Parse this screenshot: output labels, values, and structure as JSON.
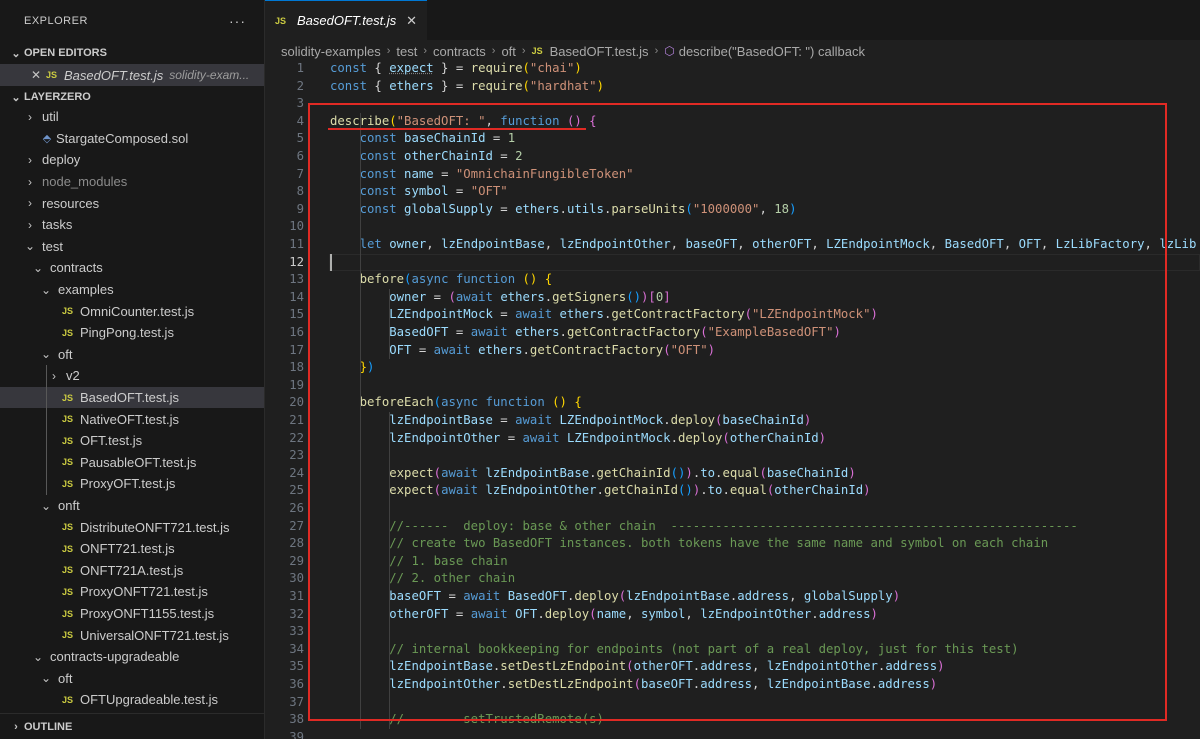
{
  "explorer": {
    "title": "EXPLORER",
    "more": "···"
  },
  "open_editors": {
    "title": "OPEN EDITORS",
    "item": {
      "icon": "js-file-icon",
      "name": "BasedOFT.test.js",
      "desc": "solidity-exam..."
    }
  },
  "workspace": {
    "title": "LAYERZERO"
  },
  "tree": [
    {
      "label": "util",
      "type": "folder",
      "expanded": false
    },
    {
      "label": "StargateComposed.sol",
      "type": "sol"
    },
    {
      "label": "deploy",
      "type": "folder",
      "expanded": false
    },
    {
      "label": "node_modules",
      "type": "folder",
      "expanded": false,
      "dim": true
    },
    {
      "label": "resources",
      "type": "folder",
      "expanded": false
    },
    {
      "label": "tasks",
      "type": "folder",
      "expanded": false
    },
    {
      "label": "test",
      "type": "folder",
      "expanded": true
    },
    {
      "label": "contracts",
      "type": "folder",
      "expanded": true
    },
    {
      "label": "examples",
      "type": "folder",
      "expanded": true
    },
    {
      "label": "OmniCounter.test.js",
      "type": "js"
    },
    {
      "label": "PingPong.test.js",
      "type": "js"
    },
    {
      "label": "oft",
      "type": "folder",
      "expanded": true
    },
    {
      "label": "v2",
      "type": "folder",
      "expanded": false
    },
    {
      "label": "BasedOFT.test.js",
      "type": "js",
      "selected": true
    },
    {
      "label": "NativeOFT.test.js",
      "type": "js"
    },
    {
      "label": "OFT.test.js",
      "type": "js"
    },
    {
      "label": "PausableOFT.test.js",
      "type": "js"
    },
    {
      "label": "ProxyOFT.test.js",
      "type": "js"
    },
    {
      "label": "onft",
      "type": "folder",
      "expanded": true
    },
    {
      "label": "DistributeONFT721.test.js",
      "type": "js"
    },
    {
      "label": "ONFT721.test.js",
      "type": "js"
    },
    {
      "label": "ONFT721A.test.js",
      "type": "js"
    },
    {
      "label": "ProxyONFT721.test.js",
      "type": "js"
    },
    {
      "label": "ProxyONFT1155.test.js",
      "type": "js"
    },
    {
      "label": "UniversalONFT721.test.js",
      "type": "js"
    },
    {
      "label": "contracts-upgradeable",
      "type": "folder",
      "expanded": true
    },
    {
      "label": "oft",
      "type": "folder",
      "expanded": true
    },
    {
      "label": "OFTUpgradeable.test.js",
      "type": "js"
    }
  ],
  "outline": {
    "title": "OUTLINE"
  },
  "tab": {
    "icon": "JS",
    "name": "BasedOFT.test.js",
    "close": "✕"
  },
  "breadcrumb": [
    "solidity-examples",
    "test",
    "contracts",
    "oft",
    "BasedOFT.test.js",
    "describe(\"BasedOFT: \") callback"
  ],
  "active_line": 12,
  "colors": {
    "highlight_box": "#e02a24",
    "accent": "#0078d4"
  },
  "code_lines": [
    [
      [
        "k",
        "const "
      ],
      [
        "p",
        "{ "
      ],
      [
        "v",
        "expect"
      ],
      [
        "p",
        " } = "
      ],
      [
        "f",
        "require"
      ],
      [
        "b1",
        "("
      ],
      [
        "s",
        "\"chai\""
      ],
      [
        "b1",
        ")"
      ]
    ],
    [
      [
        "k",
        "const "
      ],
      [
        "p",
        "{ "
      ],
      [
        "v",
        "ethers"
      ],
      [
        "p",
        " } = "
      ],
      [
        "f",
        "require"
      ],
      [
        "b1",
        "("
      ],
      [
        "s",
        "\"hardhat\""
      ],
      [
        "b1",
        ")"
      ]
    ],
    [],
    [
      [
        "f",
        "describe"
      ],
      [
        "b1",
        "("
      ],
      [
        "s",
        "\"BasedOFT: \""
      ],
      [
        "p",
        ", "
      ],
      [
        "k",
        "function"
      ],
      [
        "p",
        " "
      ],
      [
        "b2",
        "()"
      ],
      [
        "p",
        " "
      ],
      [
        "b2",
        "{"
      ]
    ],
    [
      [
        "p",
        "    "
      ],
      [
        "k",
        "const "
      ],
      [
        "v",
        "baseChainId"
      ],
      [
        "p",
        " = "
      ],
      [
        "n",
        "1"
      ]
    ],
    [
      [
        "p",
        "    "
      ],
      [
        "k",
        "const "
      ],
      [
        "v",
        "otherChainId"
      ],
      [
        "p",
        " = "
      ],
      [
        "n",
        "2"
      ]
    ],
    [
      [
        "p",
        "    "
      ],
      [
        "k",
        "const "
      ],
      [
        "v",
        "name"
      ],
      [
        "p",
        " = "
      ],
      [
        "s",
        "\"OmnichainFungibleToken\""
      ]
    ],
    [
      [
        "p",
        "    "
      ],
      [
        "k",
        "const "
      ],
      [
        "v",
        "symbol"
      ],
      [
        "p",
        " = "
      ],
      [
        "s",
        "\"OFT\""
      ]
    ],
    [
      [
        "p",
        "    "
      ],
      [
        "k",
        "const "
      ],
      [
        "v",
        "globalSupply"
      ],
      [
        "p",
        " = "
      ],
      [
        "v",
        "ethers"
      ],
      [
        "p",
        "."
      ],
      [
        "v",
        "utils"
      ],
      [
        "p",
        "."
      ],
      [
        "f",
        "parseUnits"
      ],
      [
        "b3",
        "("
      ],
      [
        "s",
        "\"1000000\""
      ],
      [
        "p",
        ", "
      ],
      [
        "n",
        "18"
      ],
      [
        "b3",
        ")"
      ]
    ],
    [],
    [
      [
        "p",
        "    "
      ],
      [
        "k",
        "let "
      ],
      [
        "v",
        "owner"
      ],
      [
        "p",
        ", "
      ],
      [
        "v",
        "lzEndpointBase"
      ],
      [
        "p",
        ", "
      ],
      [
        "v",
        "lzEndpointOther"
      ],
      [
        "p",
        ", "
      ],
      [
        "v",
        "baseOFT"
      ],
      [
        "p",
        ", "
      ],
      [
        "v",
        "otherOFT"
      ],
      [
        "p",
        ", "
      ],
      [
        "v",
        "LZEndpointMock"
      ],
      [
        "p",
        ", "
      ],
      [
        "v",
        "BasedOFT"
      ],
      [
        "p",
        ", "
      ],
      [
        "v",
        "OFT"
      ],
      [
        "p",
        ", "
      ],
      [
        "v",
        "LzLibFactory"
      ],
      [
        "p",
        ", "
      ],
      [
        "v",
        "lzLib"
      ]
    ],
    [],
    [
      [
        "p",
        "    "
      ],
      [
        "f",
        "before"
      ],
      [
        "b3",
        "("
      ],
      [
        "k",
        "async "
      ],
      [
        "k",
        "function"
      ],
      [
        "p",
        " "
      ],
      [
        "b1",
        "()"
      ],
      [
        "p",
        " "
      ],
      [
        "b1",
        "{"
      ]
    ],
    [
      [
        "p",
        "        "
      ],
      [
        "v",
        "owner"
      ],
      [
        "p",
        " = "
      ],
      [
        "b2",
        "("
      ],
      [
        "k",
        "await "
      ],
      [
        "v",
        "ethers"
      ],
      [
        "p",
        "."
      ],
      [
        "f",
        "getSigners"
      ],
      [
        "b3",
        "()"
      ],
      [
        "b2",
        ")"
      ],
      [
        "b2",
        "["
      ],
      [
        "n",
        "0"
      ],
      [
        "b2",
        "]"
      ]
    ],
    [
      [
        "p",
        "        "
      ],
      [
        "v",
        "LZEndpointMock"
      ],
      [
        "p",
        " = "
      ],
      [
        "k",
        "await "
      ],
      [
        "v",
        "ethers"
      ],
      [
        "p",
        "."
      ],
      [
        "f",
        "getContractFactory"
      ],
      [
        "b2",
        "("
      ],
      [
        "s",
        "\"LZEndpointMock\""
      ],
      [
        "b2",
        ")"
      ]
    ],
    [
      [
        "p",
        "        "
      ],
      [
        "v",
        "BasedOFT"
      ],
      [
        "p",
        " = "
      ],
      [
        "k",
        "await "
      ],
      [
        "v",
        "ethers"
      ],
      [
        "p",
        "."
      ],
      [
        "f",
        "getContractFactory"
      ],
      [
        "b2",
        "("
      ],
      [
        "s",
        "\"ExampleBasedOFT\""
      ],
      [
        "b2",
        ")"
      ]
    ],
    [
      [
        "p",
        "        "
      ],
      [
        "v",
        "OFT"
      ],
      [
        "p",
        " = "
      ],
      [
        "k",
        "await "
      ],
      [
        "v",
        "ethers"
      ],
      [
        "p",
        "."
      ],
      [
        "f",
        "getContractFactory"
      ],
      [
        "b2",
        "("
      ],
      [
        "s",
        "\"OFT\""
      ],
      [
        "b2",
        ")"
      ]
    ],
    [
      [
        "p",
        "    "
      ],
      [
        "b1",
        "}"
      ],
      [
        "b3",
        ")"
      ]
    ],
    [],
    [
      [
        "p",
        "    "
      ],
      [
        "f",
        "beforeEach"
      ],
      [
        "b3",
        "("
      ],
      [
        "k",
        "async "
      ],
      [
        "k",
        "function"
      ],
      [
        "p",
        " "
      ],
      [
        "b1",
        "()"
      ],
      [
        "p",
        " "
      ],
      [
        "b1",
        "{"
      ]
    ],
    [
      [
        "p",
        "        "
      ],
      [
        "v",
        "lzEndpointBase"
      ],
      [
        "p",
        " = "
      ],
      [
        "k",
        "await "
      ],
      [
        "v",
        "LZEndpointMock"
      ],
      [
        "p",
        "."
      ],
      [
        "f",
        "deploy"
      ],
      [
        "b2",
        "("
      ],
      [
        "v",
        "baseChainId"
      ],
      [
        "b2",
        ")"
      ]
    ],
    [
      [
        "p",
        "        "
      ],
      [
        "v",
        "lzEndpointOther"
      ],
      [
        "p",
        " = "
      ],
      [
        "k",
        "await "
      ],
      [
        "v",
        "LZEndpointMock"
      ],
      [
        "p",
        "."
      ],
      [
        "f",
        "deploy"
      ],
      [
        "b2",
        "("
      ],
      [
        "v",
        "otherChainId"
      ],
      [
        "b2",
        ")"
      ]
    ],
    [],
    [
      [
        "p",
        "        "
      ],
      [
        "f",
        "expect"
      ],
      [
        "b2",
        "("
      ],
      [
        "k",
        "await "
      ],
      [
        "v",
        "lzEndpointBase"
      ],
      [
        "p",
        "."
      ],
      [
        "f",
        "getChainId"
      ],
      [
        "b3",
        "()"
      ],
      [
        "b2",
        ")"
      ],
      [
        "p",
        "."
      ],
      [
        "v",
        "to"
      ],
      [
        "p",
        "."
      ],
      [
        "f",
        "equal"
      ],
      [
        "b2",
        "("
      ],
      [
        "v",
        "baseChainId"
      ],
      [
        "b2",
        ")"
      ]
    ],
    [
      [
        "p",
        "        "
      ],
      [
        "f",
        "expect"
      ],
      [
        "b2",
        "("
      ],
      [
        "k",
        "await "
      ],
      [
        "v",
        "lzEndpointOther"
      ],
      [
        "p",
        "."
      ],
      [
        "f",
        "getChainId"
      ],
      [
        "b3",
        "()"
      ],
      [
        "b2",
        ")"
      ],
      [
        "p",
        "."
      ],
      [
        "v",
        "to"
      ],
      [
        "p",
        "."
      ],
      [
        "f",
        "equal"
      ],
      [
        "b2",
        "("
      ],
      [
        "v",
        "otherChainId"
      ],
      [
        "b2",
        ")"
      ]
    ],
    [],
    [
      [
        "p",
        "        "
      ],
      [
        "c",
        "//------  deploy: base & other chain  -------------------------------------------------------"
      ]
    ],
    [
      [
        "p",
        "        "
      ],
      [
        "c",
        "// create two BasedOFT instances. both tokens have the same name and symbol on each chain"
      ]
    ],
    [
      [
        "p",
        "        "
      ],
      [
        "c",
        "// 1. base chain"
      ]
    ],
    [
      [
        "p",
        "        "
      ],
      [
        "c",
        "// 2. other chain"
      ]
    ],
    [
      [
        "p",
        "        "
      ],
      [
        "v",
        "baseOFT"
      ],
      [
        "p",
        " = "
      ],
      [
        "k",
        "await "
      ],
      [
        "v",
        "BasedOFT"
      ],
      [
        "p",
        "."
      ],
      [
        "f",
        "deploy"
      ],
      [
        "b2",
        "("
      ],
      [
        "v",
        "lzEndpointBase"
      ],
      [
        "p",
        "."
      ],
      [
        "v",
        "address"
      ],
      [
        "p",
        ", "
      ],
      [
        "v",
        "globalSupply"
      ],
      [
        "b2",
        ")"
      ]
    ],
    [
      [
        "p",
        "        "
      ],
      [
        "v",
        "otherOFT"
      ],
      [
        "p",
        " = "
      ],
      [
        "k",
        "await "
      ],
      [
        "v",
        "OFT"
      ],
      [
        "p",
        "."
      ],
      [
        "f",
        "deploy"
      ],
      [
        "b2",
        "("
      ],
      [
        "v",
        "name"
      ],
      [
        "p",
        ", "
      ],
      [
        "v",
        "symbol"
      ],
      [
        "p",
        ", "
      ],
      [
        "v",
        "lzEndpointOther"
      ],
      [
        "p",
        "."
      ],
      [
        "v",
        "address"
      ],
      [
        "b2",
        ")"
      ]
    ],
    [],
    [
      [
        "p",
        "        "
      ],
      [
        "c",
        "// internal bookkeeping for endpoints (not part of a real deploy, just for this test)"
      ]
    ],
    [
      [
        "p",
        "        "
      ],
      [
        "v",
        "lzEndpointBase"
      ],
      [
        "p",
        "."
      ],
      [
        "f",
        "setDestLzEndpoint"
      ],
      [
        "b2",
        "("
      ],
      [
        "v",
        "otherOFT"
      ],
      [
        "p",
        "."
      ],
      [
        "v",
        "address"
      ],
      [
        "p",
        ", "
      ],
      [
        "v",
        "lzEndpointOther"
      ],
      [
        "p",
        "."
      ],
      [
        "v",
        "address"
      ],
      [
        "b2",
        ")"
      ]
    ],
    [
      [
        "p",
        "        "
      ],
      [
        "v",
        "lzEndpointOther"
      ],
      [
        "p",
        "."
      ],
      [
        "f",
        "setDestLzEndpoint"
      ],
      [
        "b2",
        "("
      ],
      [
        "v",
        "baseOFT"
      ],
      [
        "p",
        "."
      ],
      [
        "v",
        "address"
      ],
      [
        "p",
        ", "
      ],
      [
        "v",
        "lzEndpointBase"
      ],
      [
        "p",
        "."
      ],
      [
        "v",
        "address"
      ],
      [
        "b2",
        ")"
      ]
    ],
    [],
    [
      [
        "p",
        "        "
      ],
      [
        "c",
        "//------  setTrustedRemote(s) -------------------------------------------------------"
      ]
    ],
    [
      [
        "p",
        "        "
      ],
      [
        "c",
        ""
      ]
    ]
  ]
}
